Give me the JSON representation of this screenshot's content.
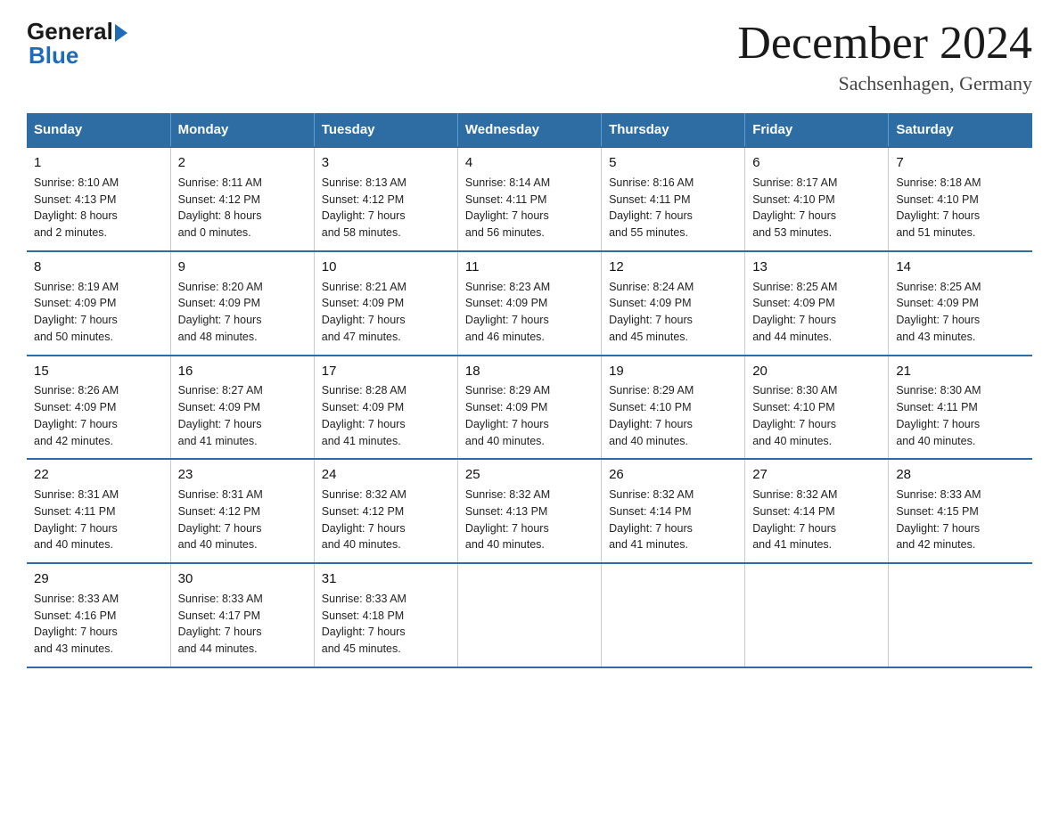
{
  "logo": {
    "general": "General",
    "blue": "Blue"
  },
  "title": {
    "month_year": "December 2024",
    "location": "Sachsenhagen, Germany"
  },
  "days_of_week": [
    "Sunday",
    "Monday",
    "Tuesday",
    "Wednesday",
    "Thursday",
    "Friday",
    "Saturday"
  ],
  "weeks": [
    [
      {
        "day": "1",
        "sunrise": "Sunrise: 8:10 AM",
        "sunset": "Sunset: 4:13 PM",
        "daylight": "Daylight: 8 hours",
        "daylight2": "and 2 minutes."
      },
      {
        "day": "2",
        "sunrise": "Sunrise: 8:11 AM",
        "sunset": "Sunset: 4:12 PM",
        "daylight": "Daylight: 8 hours",
        "daylight2": "and 0 minutes."
      },
      {
        "day": "3",
        "sunrise": "Sunrise: 8:13 AM",
        "sunset": "Sunset: 4:12 PM",
        "daylight": "Daylight: 7 hours",
        "daylight2": "and 58 minutes."
      },
      {
        "day": "4",
        "sunrise": "Sunrise: 8:14 AM",
        "sunset": "Sunset: 4:11 PM",
        "daylight": "Daylight: 7 hours",
        "daylight2": "and 56 minutes."
      },
      {
        "day": "5",
        "sunrise": "Sunrise: 8:16 AM",
        "sunset": "Sunset: 4:11 PM",
        "daylight": "Daylight: 7 hours",
        "daylight2": "and 55 minutes."
      },
      {
        "day": "6",
        "sunrise": "Sunrise: 8:17 AM",
        "sunset": "Sunset: 4:10 PM",
        "daylight": "Daylight: 7 hours",
        "daylight2": "and 53 minutes."
      },
      {
        "day": "7",
        "sunrise": "Sunrise: 8:18 AM",
        "sunset": "Sunset: 4:10 PM",
        "daylight": "Daylight: 7 hours",
        "daylight2": "and 51 minutes."
      }
    ],
    [
      {
        "day": "8",
        "sunrise": "Sunrise: 8:19 AM",
        "sunset": "Sunset: 4:09 PM",
        "daylight": "Daylight: 7 hours",
        "daylight2": "and 50 minutes."
      },
      {
        "day": "9",
        "sunrise": "Sunrise: 8:20 AM",
        "sunset": "Sunset: 4:09 PM",
        "daylight": "Daylight: 7 hours",
        "daylight2": "and 48 minutes."
      },
      {
        "day": "10",
        "sunrise": "Sunrise: 8:21 AM",
        "sunset": "Sunset: 4:09 PM",
        "daylight": "Daylight: 7 hours",
        "daylight2": "and 47 minutes."
      },
      {
        "day": "11",
        "sunrise": "Sunrise: 8:23 AM",
        "sunset": "Sunset: 4:09 PM",
        "daylight": "Daylight: 7 hours",
        "daylight2": "and 46 minutes."
      },
      {
        "day": "12",
        "sunrise": "Sunrise: 8:24 AM",
        "sunset": "Sunset: 4:09 PM",
        "daylight": "Daylight: 7 hours",
        "daylight2": "and 45 minutes."
      },
      {
        "day": "13",
        "sunrise": "Sunrise: 8:25 AM",
        "sunset": "Sunset: 4:09 PM",
        "daylight": "Daylight: 7 hours",
        "daylight2": "and 44 minutes."
      },
      {
        "day": "14",
        "sunrise": "Sunrise: 8:25 AM",
        "sunset": "Sunset: 4:09 PM",
        "daylight": "Daylight: 7 hours",
        "daylight2": "and 43 minutes."
      }
    ],
    [
      {
        "day": "15",
        "sunrise": "Sunrise: 8:26 AM",
        "sunset": "Sunset: 4:09 PM",
        "daylight": "Daylight: 7 hours",
        "daylight2": "and 42 minutes."
      },
      {
        "day": "16",
        "sunrise": "Sunrise: 8:27 AM",
        "sunset": "Sunset: 4:09 PM",
        "daylight": "Daylight: 7 hours",
        "daylight2": "and 41 minutes."
      },
      {
        "day": "17",
        "sunrise": "Sunrise: 8:28 AM",
        "sunset": "Sunset: 4:09 PM",
        "daylight": "Daylight: 7 hours",
        "daylight2": "and 41 minutes."
      },
      {
        "day": "18",
        "sunrise": "Sunrise: 8:29 AM",
        "sunset": "Sunset: 4:09 PM",
        "daylight": "Daylight: 7 hours",
        "daylight2": "and 40 minutes."
      },
      {
        "day": "19",
        "sunrise": "Sunrise: 8:29 AM",
        "sunset": "Sunset: 4:10 PM",
        "daylight": "Daylight: 7 hours",
        "daylight2": "and 40 minutes."
      },
      {
        "day": "20",
        "sunrise": "Sunrise: 8:30 AM",
        "sunset": "Sunset: 4:10 PM",
        "daylight": "Daylight: 7 hours",
        "daylight2": "and 40 minutes."
      },
      {
        "day": "21",
        "sunrise": "Sunrise: 8:30 AM",
        "sunset": "Sunset: 4:11 PM",
        "daylight": "Daylight: 7 hours",
        "daylight2": "and 40 minutes."
      }
    ],
    [
      {
        "day": "22",
        "sunrise": "Sunrise: 8:31 AM",
        "sunset": "Sunset: 4:11 PM",
        "daylight": "Daylight: 7 hours",
        "daylight2": "and 40 minutes."
      },
      {
        "day": "23",
        "sunrise": "Sunrise: 8:31 AM",
        "sunset": "Sunset: 4:12 PM",
        "daylight": "Daylight: 7 hours",
        "daylight2": "and 40 minutes."
      },
      {
        "day": "24",
        "sunrise": "Sunrise: 8:32 AM",
        "sunset": "Sunset: 4:12 PM",
        "daylight": "Daylight: 7 hours",
        "daylight2": "and 40 minutes."
      },
      {
        "day": "25",
        "sunrise": "Sunrise: 8:32 AM",
        "sunset": "Sunset: 4:13 PM",
        "daylight": "Daylight: 7 hours",
        "daylight2": "and 40 minutes."
      },
      {
        "day": "26",
        "sunrise": "Sunrise: 8:32 AM",
        "sunset": "Sunset: 4:14 PM",
        "daylight": "Daylight: 7 hours",
        "daylight2": "and 41 minutes."
      },
      {
        "day": "27",
        "sunrise": "Sunrise: 8:32 AM",
        "sunset": "Sunset: 4:14 PM",
        "daylight": "Daylight: 7 hours",
        "daylight2": "and 41 minutes."
      },
      {
        "day": "28",
        "sunrise": "Sunrise: 8:33 AM",
        "sunset": "Sunset: 4:15 PM",
        "daylight": "Daylight: 7 hours",
        "daylight2": "and 42 minutes."
      }
    ],
    [
      {
        "day": "29",
        "sunrise": "Sunrise: 8:33 AM",
        "sunset": "Sunset: 4:16 PM",
        "daylight": "Daylight: 7 hours",
        "daylight2": "and 43 minutes."
      },
      {
        "day": "30",
        "sunrise": "Sunrise: 8:33 AM",
        "sunset": "Sunset: 4:17 PM",
        "daylight": "Daylight: 7 hours",
        "daylight2": "and 44 minutes."
      },
      {
        "day": "31",
        "sunrise": "Sunrise: 8:33 AM",
        "sunset": "Sunset: 4:18 PM",
        "daylight": "Daylight: 7 hours",
        "daylight2": "and 45 minutes."
      },
      null,
      null,
      null,
      null
    ]
  ]
}
